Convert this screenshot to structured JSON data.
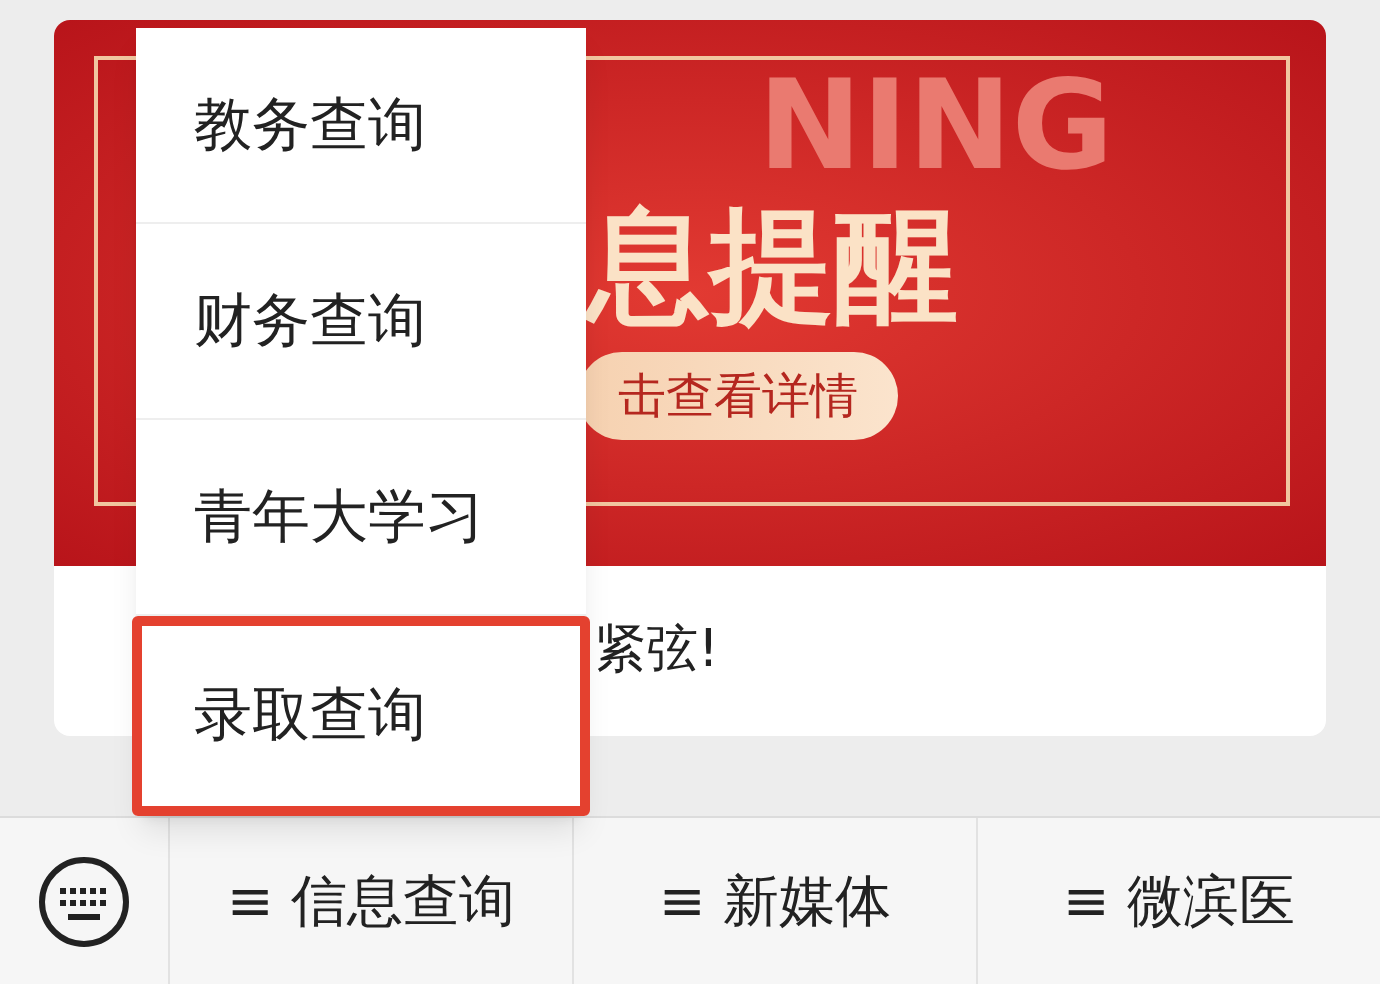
{
  "banner": {
    "watermark": "NING",
    "headline": "息提醒",
    "button": "击查看详情"
  },
  "caption": "紧弦!",
  "menu": {
    "items": [
      {
        "label": "教务查询",
        "highlighted": false
      },
      {
        "label": "财务查询",
        "highlighted": false
      },
      {
        "label": "青年大学习",
        "highlighted": false
      },
      {
        "label": "录取查询",
        "highlighted": true
      }
    ]
  },
  "bottom_bar": {
    "items": [
      {
        "icon": "≡",
        "label": "信息查询"
      },
      {
        "icon": "≡",
        "label": "新媒体"
      },
      {
        "icon": "≡",
        "label": "微滨医"
      }
    ]
  }
}
